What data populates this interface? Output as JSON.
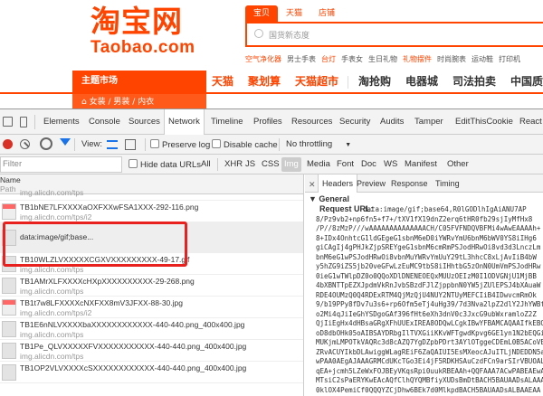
{
  "site": {
    "logo_cn": "淘宝网",
    "logo_en": "Taobao.com",
    "search_tabs": [
      "宝贝",
      "天猫",
      "店铺"
    ],
    "search_placeholder": "国货新态度",
    "hot_words": [
      "空气净化器",
      "男士手表",
      "台灯",
      "手表女",
      "生日礼物",
      "礼物摆件",
      "时尚腕表",
      "运动鞋",
      "打印机"
    ],
    "hot_red": [
      0,
      2,
      5
    ],
    "theme_label": "主题市场",
    "nav_left": [
      "天猫",
      "聚划算",
      "天猫超市"
    ],
    "nav_right": [
      "淘抢购",
      "电器城",
      "司法拍卖",
      "中国质造"
    ],
    "category": "女装 / 男装 / 内衣",
    "accent": "#ff4400"
  },
  "devtools": {
    "tabs": [
      "Elements",
      "Console",
      "Sources",
      "Network",
      "Timeline",
      "Profiles",
      "Resources",
      "Security",
      "Audits",
      "Tamper",
      "EditThisCookie",
      "React"
    ],
    "active_tab": "Network",
    "controls": {
      "view_label": "View:",
      "preserve_log": "Preserve log",
      "disable_cache": "Disable cache",
      "throttle": "No throttling"
    },
    "filter": {
      "placeholder": "Filter",
      "hide_data_urls": "Hide data URLs",
      "types": [
        "All",
        "XHR",
        "JS",
        "CSS",
        "Img",
        "Media",
        "Font",
        "Doc",
        "WS",
        "Manifest",
        "Other"
      ],
      "active_type": "Img"
    },
    "list": {
      "col_name": "Name",
      "col_path": "Path",
      "rows": [
        {
          "name": "",
          "domain": "img.alicdn.com/tps"
        },
        {
          "name": "TB1bNE7LFXXXXaOXFXXwFSA1XXX-292-116.png",
          "domain": "img.alicdn.com/tps/i2"
        },
        {
          "name": "data:image/gif;base...",
          "domain": ""
        },
        {
          "name": "TB10WLZLVXXXXXCGXVXXXXXXXXX-49-17.gif",
          "domain": "img.alicdn.com/tps"
        },
        {
          "name": "TB1AMrXLFXXXXcHXpXXXXXXXXXX-29-268.png",
          "domain": "img.alicdn.com/tps"
        },
        {
          "name": "TB1t7w8LFXXXXcNXFXX8mV3JFXX-88-30.jpg",
          "domain": "img.alicdn.com/tps/i2"
        },
        {
          "name": "TB1E6nNLVXXXXbaXXXXXXXXXXXX-440-440.png_400x400.jpg",
          "domain": "img.alicdn.com/tps"
        },
        {
          "name": "TB1Pe_QLVXXXXXFVXXXXXXXXXXX-440-440.png_400x400.jpg",
          "domain": "img.alicdn.com/tps"
        },
        {
          "name": "TB1OP2VLVXXXXcSXXXXXXXXXXXX-440-440.png_400x400.jpg",
          "domain": ""
        }
      ]
    },
    "headers": {
      "tabs": [
        "Headers",
        "Preview",
        "Response",
        "Timing"
      ],
      "active": "Headers",
      "section": "General",
      "request_url_label": "Request URL:",
      "request_url_lines": [
        "data:image/gif;base64,R0lGODlhIgAiANU7AP",
        "8/Pz9vb2+np6fn5+f7+/tXV1fX19dnZ2erq6tHR0fb29sjIyMfHx8",
        "/P//8zMzP///wAAAAAAAAAAAAAACH/C05FVFNDQVBFMi4wAwEAAAAh+",
        "8+IDx4OnhtcG1ldGEgeG1sbnM6eD0iYWRvYmU6bnM6bWV0YS8iIHg6",
        "giCAgIj4gPHJkZjpSREYgeG1sbnM6cmRmPSJodHRwOi8vd3d3LnczLm",
        "bnM6eG1wPSJodHRwOi8vbnMuYWRvYmUuY29tL3hhcC8xLjAvIiB4bW",
        "y5hZG9iZS5jb20veGFwLzEuMC9tbS8iIHhtbG5zOnN0UmVmPSJodHRw",
        "0ieG1wTWlpDZ0o0QQoXDlDNENEOEQxMUUzOEIzM0I1ODVGNjU1MjBB",
        "4bXBNTTpEZXJpdmVkRnJvbSBzdFJlZjppbnN0YW5jZUlEPSJ4bXAuaW",
        "RDE4OUMzQ0Q4RDExRTM4QjMzQjU4NUY2NTUyMEFCIiB4IDwvcmRmOk",
        "9/b19PPy8fDv7u3s6+rp6Ofm5eTj4uHg39/7d3Nva2lpZ2dlY2JhYWBf",
        "o2Mi4qJiIeGhYSDgoGAf396fHt6eXh3dnV0c3JxcG9ubWxramloZ2Z",
        "QjIiEgHx4dHBsaGRgXFhUUExIREA8ODQwLCgkIBwYFBAMCAQAAIfkEBQ",
        "oD8dbOHk05oAIBSAYDRbgIlTVXGiiKKvWFTgwdKpvg6GE1yn1N2bEQGiEA",
        "MUKjmLMPOTkVAQRc3d8cAZQ7YgDZpbPDrt3AYlOTggeCDEmL0B5ACoVEkA",
        "ZRvACUYIkbDLAwiggWLagREiF6ZaQAIUI5EsMXeocAJuITLjNDEDDN5aR",
        "wPAA0AEgAJAAAGRMCdUKcTGo3Ei4jF5RDKHSAuCzdFCn9arSIrVBUOALIV",
        "qEA+jcmh5LZeWxFOJBEyVKqsRpi0uukRBEAAh+QQFAAA7ACwPABEAEwAE",
        "MTsiC2sPaERYKwEAcAQfClhQYQMBfiyXUDsBmDtBACH5BAUAADsALAAAA",
        "0klOX4PemiCf0QQQYZCjDhw6BEk7d0MlkpdBACH5BAUAADsALBAAEAA"
      ]
    }
  }
}
